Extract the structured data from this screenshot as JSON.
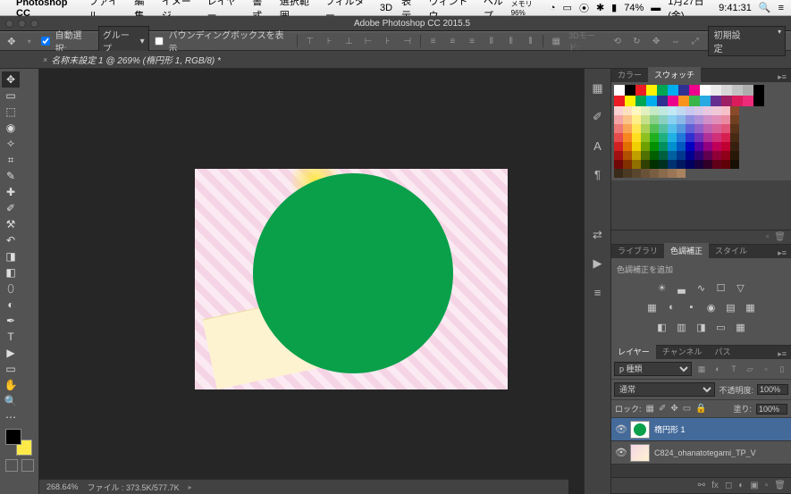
{
  "mac_menu": {
    "app": "Photoshop CC",
    "items": [
      "ファイル",
      "編集",
      "イメージ",
      "レイヤー",
      "書式",
      "選択範囲",
      "フィルター",
      "3D",
      "表示",
      "ウィンドウ",
      "ヘルプ"
    ],
    "mem_label": "メモリ 96%",
    "battery": "74%",
    "date": "1月27日(金)",
    "time": "9:41:31"
  },
  "window_title": "Adobe Photoshop CC 2015.5",
  "doc_tab": "名称未設定 1 @ 269% (楕円形 1, RGB/8) *",
  "options": {
    "move_icon": "✥",
    "auto_select_label": "自動選択:",
    "group_label": "グループ",
    "show_bbox_label": "バウンディングボックスを表示",
    "mode3d_label": "3Dモード:",
    "preset_label": "初期設定"
  },
  "status": {
    "zoom": "268.64%",
    "file_label": "ファイル : 373.5K/577.7K"
  },
  "panels": {
    "color_tab": "カラー",
    "swatches_tab": "スウォッチ",
    "library_tab": "ライブラリ",
    "adjustments_tab": "色調補正",
    "styles_tab": "スタイル",
    "layers_tab": "レイヤー",
    "channels_tab": "チャンネル",
    "paths_tab": "パス"
  },
  "adjustments": {
    "add_msg": "色調補正を追加"
  },
  "layers": {
    "filter_kind": "p 種類",
    "blend_mode": "通常",
    "opacity_label": "不透明度:",
    "opacity_value": "100%",
    "lock_label": "ロック:",
    "fill_label": "塗り:",
    "fill_value": "100%",
    "items": [
      {
        "name": "楕円形 1"
      },
      {
        "name": "C824_ohanatotegami_TP_V"
      }
    ]
  },
  "swatch_colors": {
    "row1": [
      "#ffffff",
      "#000000",
      "#ed1c24",
      "#fff200",
      "#00a651",
      "#00aeef",
      "#2e3192",
      "#ec008c",
      "#ffffff",
      "#ebebeb",
      "#d7d7d7",
      "#c2c2c2",
      "#adadad",
      "#000000"
    ],
    "row2": [
      "#ed1c24",
      "#fff200",
      "#00a651",
      "#00aeef",
      "#2e3192",
      "#ec008c",
      "#f7941d",
      "#39b54a",
      "#27aae1",
      "#662d91",
      "#9e1f63",
      "#da1c5c",
      "#ee2a7b",
      "#000000"
    ],
    "grid": [
      [
        "#f9d2d2",
        "#fde0c0",
        "#fff7c0",
        "#e2f0c0",
        "#c5e8c5",
        "#c0e8e0",
        "#c0e8f5",
        "#c0d8f0",
        "#c8c8f0",
        "#d8c8e8",
        "#e8c8e0",
        "#f0c8d8",
        "#f5c0c8",
        "#8a4a2a"
      ],
      [
        "#f3a5a5",
        "#fbc28a",
        "#ffef8a",
        "#c6e08a",
        "#8ad08a",
        "#8ad0c0",
        "#8ad0f0",
        "#8ab8e8",
        "#9090e0",
        "#b090d8",
        "#d090c8",
        "#e090b8",
        "#ea8aa0",
        "#704020"
      ],
      [
        "#ec7878",
        "#f9a454",
        "#ffe754",
        "#aad054",
        "#54c054",
        "#54c0a0",
        "#54c0ea",
        "#5498e0",
        "#6060d8",
        "#9060c8",
        "#c060b0",
        "#d86098",
        "#e05478",
        "#5a3418"
      ],
      [
        "#e54b4b",
        "#f78620",
        "#ffdf20",
        "#8ec020",
        "#20b020",
        "#20b080",
        "#20b0e4",
        "#2078d8",
        "#3030d0",
        "#7030b8",
        "#b03098",
        "#d03078",
        "#d62050",
        "#482a14"
      ],
      [
        "#d02020",
        "#e07000",
        "#f0d000",
        "#70a000",
        "#009000",
        "#009060",
        "#0090d0",
        "#0058c0",
        "#0000c0",
        "#5000a0",
        "#900080",
        "#c00058",
        "#c00030",
        "#382010"
      ],
      [
        "#a01010",
        "#b05000",
        "#c0a000",
        "#507000",
        "#006000",
        "#006040",
        "#0060a0",
        "#003890",
        "#000090",
        "#300070",
        "#600050",
        "#900038",
        "#900018",
        "#281808"
      ],
      [
        "#700808",
        "#803000",
        "#907000",
        "#304000",
        "#003000",
        "#003020",
        "#003070",
        "#001860",
        "#000060",
        "#180040",
        "#300028",
        "#600018",
        "#600008",
        "#181004"
      ]
    ],
    "row_last": [
      "#3a2a1a",
      "#4a3a24",
      "#5a462e",
      "#6a5238",
      "#7a5e42",
      "#8a6a4c",
      "#9a7656",
      "#aa8260"
    ]
  }
}
